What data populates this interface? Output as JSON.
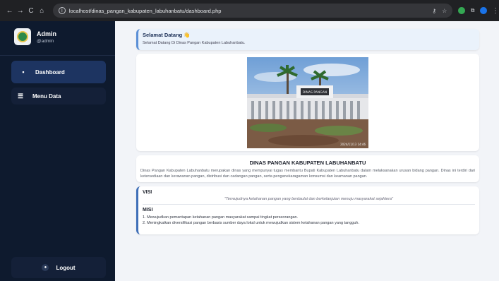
{
  "browser": {
    "url": "localhost/dinas_pangan_kabupaten_labuhanbatu/dashboard.php",
    "back_icon": "←",
    "forward_icon": "→",
    "reload_icon": "C",
    "home_icon": "⌂",
    "info_icon": "i",
    "key_icon": "⚷",
    "star_icon": "☆",
    "extension_icon": "⧉",
    "menu_icon": "⋮"
  },
  "sidebar": {
    "user_name": "Admin",
    "user_handle": "@admin",
    "items": [
      {
        "label": "Dashboard",
        "icon": "▪"
      },
      {
        "label": "Menu Data",
        "icon": "☰"
      }
    ],
    "logout_label": "Logout",
    "logout_icon": "●"
  },
  "welcome": {
    "title": "Selamat Datang",
    "emoji": "👋",
    "text": "Selamat Datang Di Dinas Pangan Kabupaten Labuhanbatu."
  },
  "about": {
    "title": "DINAS PANGAN KABUPATEN LABUHANBATU",
    "text": "Dinas Pangan Kabupaten Labuhanbatu merupakan dinas yang mempunyai tugas membantu Bupati Kabupaten Labuhanbatu dalam melaksanakan urusan bidang pangan. Dinas ini terdiri dari ketersediaan dan kerawanan pangan, distribusi dan cadangan pangan, serta penganekaragaman konsumsi dan keamanan pangan."
  },
  "visi": {
    "heading": "VISI",
    "text": "\"Terwujudnya ketahanan pangan yang berdaulat dan berkelanjutan menuju masyarakat sejahtera\""
  },
  "misi": {
    "heading": "MISI",
    "items": [
      "1. Mewujudkan pemantapan ketahanan pangan masyarakat sampai tingkat perseorangan.",
      "2. Meningkatkan diversifikasi pangan berbasis sumber daya lokal untuk mewujudkan sistem ketahanan pangan yang tangguh."
    ]
  },
  "photo": {
    "building_sign": "DINAS PANGAN",
    "timestamp": "2024/11/13 14:46"
  },
  "colors": {
    "sidebar_bg": "#0e1a2e",
    "active_item": "#1d3461",
    "accent": "#3f6fb8"
  }
}
